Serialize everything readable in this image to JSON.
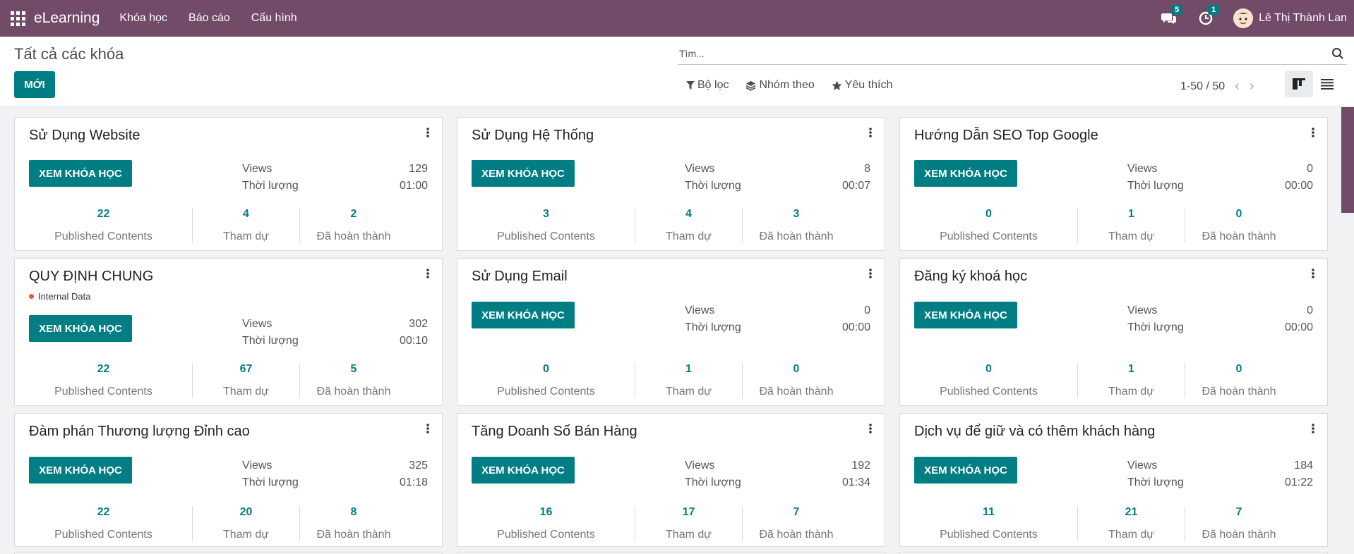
{
  "navbar": {
    "brand": "eLearning",
    "menus": [
      "Khóa học",
      "Báo cáo",
      "Cấu hình"
    ],
    "messages_count": "5",
    "activities_count": "1",
    "user_name": "Lê Thị Thành Lan",
    "color": "#714b67"
  },
  "control": {
    "breadcrumb": "Tất cả các khóa",
    "new_label": "MỚI",
    "search_placeholder": "Tìm...",
    "filter_label": "Bộ lọc",
    "group_label": "Nhóm theo",
    "favorite_label": "Yêu thích",
    "pager": "1-50 / 50"
  },
  "labels": {
    "view_course": "XEM KHÓA HỌC",
    "views": "Views",
    "duration": "Thời lượng",
    "published": "Published Contents",
    "attendees": "Tham dự",
    "completed": "Đã hoàn thành"
  },
  "accent": "#017e84",
  "courses": [
    {
      "title": "Sử Dụng Website",
      "tag": "",
      "views": "129",
      "duration": "01:00",
      "published": "22",
      "attendees": "4",
      "completed": "2"
    },
    {
      "title": "Sử Dụng Hệ Thống",
      "tag": "",
      "views": "8",
      "duration": "00:07",
      "published": "3",
      "attendees": "4",
      "completed": "3"
    },
    {
      "title": "Hướng Dẫn SEO Top Google",
      "tag": "",
      "views": "0",
      "duration": "00:00",
      "published": "0",
      "attendees": "1",
      "completed": "0"
    },
    {
      "title": "QUY ĐỊNH CHUNG",
      "tag": "Internal Data",
      "views": "302",
      "duration": "00:10",
      "published": "22",
      "attendees": "67",
      "completed": "5"
    },
    {
      "title": "Sử Dụng Email",
      "tag": "",
      "views": "0",
      "duration": "00:00",
      "published": "0",
      "attendees": "1",
      "completed": "0"
    },
    {
      "title": "Đăng ký khoá học",
      "tag": "",
      "views": "0",
      "duration": "00:00",
      "published": "0",
      "attendees": "1",
      "completed": "0"
    },
    {
      "title": "Đàm phán Thương lượng Đỉnh cao",
      "tag": "",
      "views": "325",
      "duration": "01:18",
      "published": "22",
      "attendees": "20",
      "completed": "8"
    },
    {
      "title": "Tăng Doanh Số Bán Hàng",
      "tag": "",
      "views": "192",
      "duration": "01:34",
      "published": "16",
      "attendees": "17",
      "completed": "7"
    },
    {
      "title": "Dịch vụ để giữ và có thêm khách hàng",
      "tag": "",
      "views": "184",
      "duration": "01:22",
      "published": "11",
      "attendees": "21",
      "completed": "7"
    }
  ]
}
